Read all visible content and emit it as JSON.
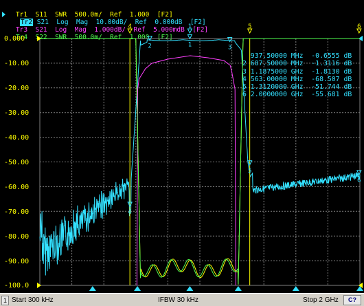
{
  "traces": [
    {
      "id": "Tr1",
      "text": "Tr1  S11  SWR  500.0m/  Ref  1.000  [F2]",
      "color": "#ffff00"
    },
    {
      "id": "Tr2",
      "tag": "Tr2",
      "text": " S21  Log  Mag  10.00dB/  Ref  0.000dB  [F2]",
      "color": "#33e0ff"
    },
    {
      "id": "Tr3",
      "text": "Tr3  S21  Log  Mag  1.000dB/  Ref  5.000mdB  [F2]",
      "color": "#ff40ff"
    },
    {
      "id": "Tr4",
      "text": "Tr4  S22  SWR  500.0m/  Ref  1.000  [F2]",
      "color": "#50ff50"
    }
  ],
  "y_axis_labels": [
    "0.000",
    "-10.00",
    "-20.00",
    "-30.00",
    "-40.00",
    "-50.00",
    "-60.00",
    "-70.00",
    "-80.00",
    "-90.00",
    "-100.0"
  ],
  "markers": [
    {
      "num": "1",
      "freq": "937.50000 MHz",
      "val": "-0.6555 dB"
    },
    {
      "num": "2",
      "freq": "687.50000 MHz",
      "val": "-1.3116 dB"
    },
    {
      "num": "3",
      "freq": "1.1875000 GHz",
      "val": "-1.8130 dB"
    },
    {
      "num": "4",
      "freq": "563.00000 MHz",
      "val": "-68.507 dB"
    },
    {
      "num": "5",
      "freq": "1.3120000 GHz",
      "val": "-51.744 dB"
    },
    {
      "num": "6",
      "freq": "2.0000000 GHz",
      "val": "-55.681 dB"
    }
  ],
  "marker_table_lines": [
    "  937.50000 MHz  -0.6555 dB",
    "2 687.50000 MHz  -1.3116 dB",
    "3 1.1875000 GHz  -1.8130 dB",
    "4 563.00000 MHz  -68.507 dB",
    "5 1.3120000 GHz  -51.744 dB",
    "6 2.0000000 GHz  -55.681 dB"
  ],
  "status": {
    "channel": "1",
    "start": "Start 300 kHz",
    "ifbw": "IFBW 30 kHz",
    "stop": "Stop 2 GHz",
    "cal": "C?"
  },
  "colors": {
    "grid": "#808080",
    "s21_log": "#33e0ff",
    "s21_fine": "#ff40ff",
    "s11_swr": "#ffff00",
    "s22_swr": "#50ff50",
    "status_bg": "#d4d0c8"
  }
}
